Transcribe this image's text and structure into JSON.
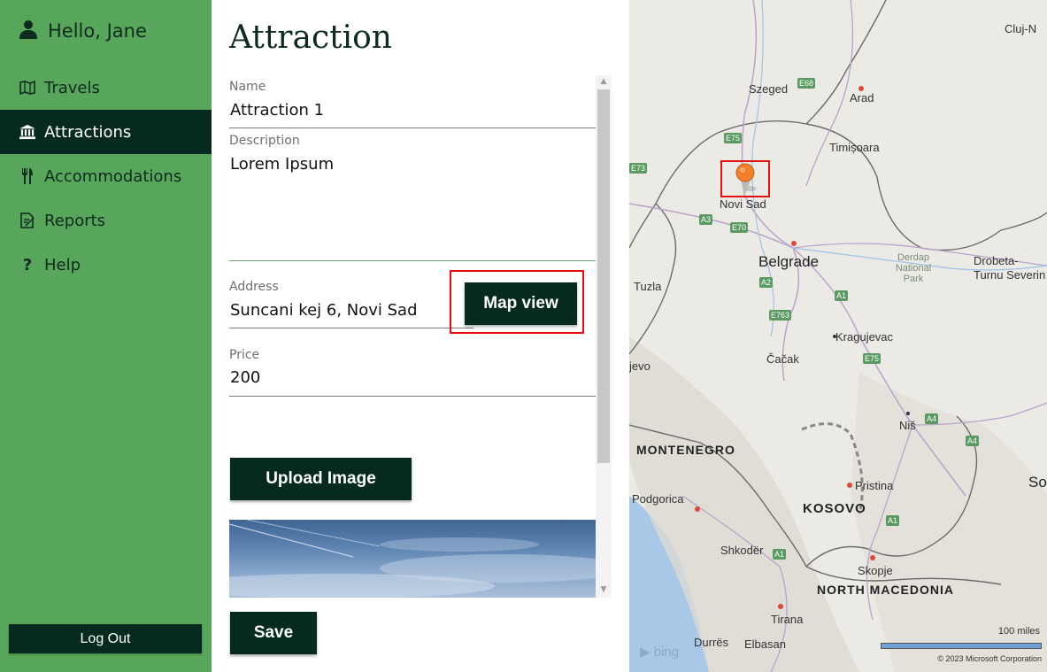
{
  "sidebar": {
    "greeting": "Hello, Jane",
    "items": [
      {
        "label": "Travels",
        "icon": "map-icon"
      },
      {
        "label": "Attractions",
        "icon": "landmark-icon",
        "active": true
      },
      {
        "label": "Accommodations",
        "icon": "utensils-icon"
      },
      {
        "label": "Reports",
        "icon": "report-icon"
      },
      {
        "label": "Help",
        "icon": "help-icon"
      }
    ],
    "logout_label": "Log Out"
  },
  "form": {
    "title": "Attraction",
    "name_label": "Name",
    "name_value": "Attraction 1",
    "description_label": "Description",
    "description_value": "Lorem Ipsum",
    "address_label": "Address",
    "address_value": "Suncani kej 6, Novi Sad",
    "map_view_label": "Map view",
    "price_label": "Price",
    "price_value": "200",
    "upload_label": "Upload Image",
    "save_label": "Save"
  },
  "map": {
    "cities": [
      "Cluj-N",
      "Szeged",
      "Arad",
      "Timișoara",
      "Novi Sad",
      "Belgrade",
      "Drobeta-Turnu Severin",
      "Tuzla",
      "Kragujevac",
      "Čačak",
      "jevo",
      "Niš",
      "Pristina",
      "Podgorica",
      "Shkodër",
      "Skopje",
      "Tirana",
      "Durrës",
      "Elbasan",
      "So"
    ],
    "countries": [
      "MONTENEGRO",
      "KOSOVO",
      "NORTH MACEDONIA"
    ],
    "roads": [
      "E68",
      "E75",
      "E73",
      "A3",
      "E70",
      "A2",
      "A1",
      "E763",
      "E75",
      "A4",
      "A4",
      "A1",
      "A1"
    ],
    "parks": [
      "Derdap National Park"
    ],
    "scale_label": "100 miles",
    "logo": "bing",
    "copyright": "© 2023 Microsoft Corporation",
    "pin_location": "Novi Sad"
  },
  "colors": {
    "sidebar": "#58a65b",
    "dark": "#062a20",
    "highlight": "#e01010",
    "pin": "#f07f2e"
  }
}
